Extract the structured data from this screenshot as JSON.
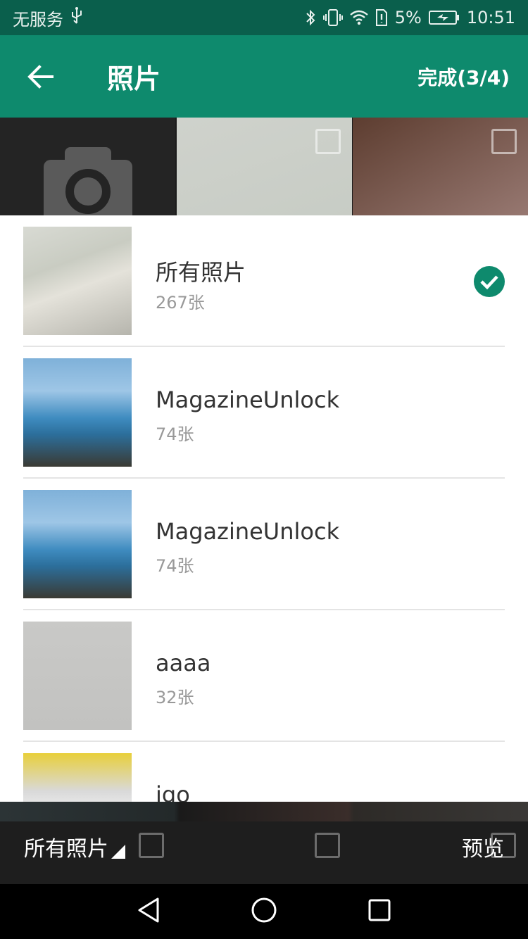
{
  "status_bar": {
    "carrier": "无服务",
    "battery_percent": "5%",
    "time": "10:51",
    "icons": [
      "usb-icon",
      "bluetooth-icon",
      "vibrate-icon",
      "wifi-icon",
      "sim-icon",
      "battery-icon"
    ]
  },
  "app_bar": {
    "title": "照片",
    "done_label": "完成(3/4)",
    "back_icon": "arrow-left-icon"
  },
  "albums": [
    {
      "name": "所有照片",
      "count": "267张",
      "selected": true
    },
    {
      "name": "MagazineUnlock",
      "count": "74张",
      "selected": false
    },
    {
      "name": "MagazineUnlock",
      "count": "74张",
      "selected": false
    },
    {
      "name": "aaaa",
      "count": "32张",
      "selected": false
    },
    {
      "name": "igo",
      "count": "",
      "selected": false
    }
  ],
  "bottom_bar": {
    "album_switch_label": "所有照片",
    "preview_label": "预览"
  },
  "colors": {
    "status_bar": "#0a5f4c",
    "app_bar": "#0e8a6d",
    "check": "#0e8a6d"
  }
}
